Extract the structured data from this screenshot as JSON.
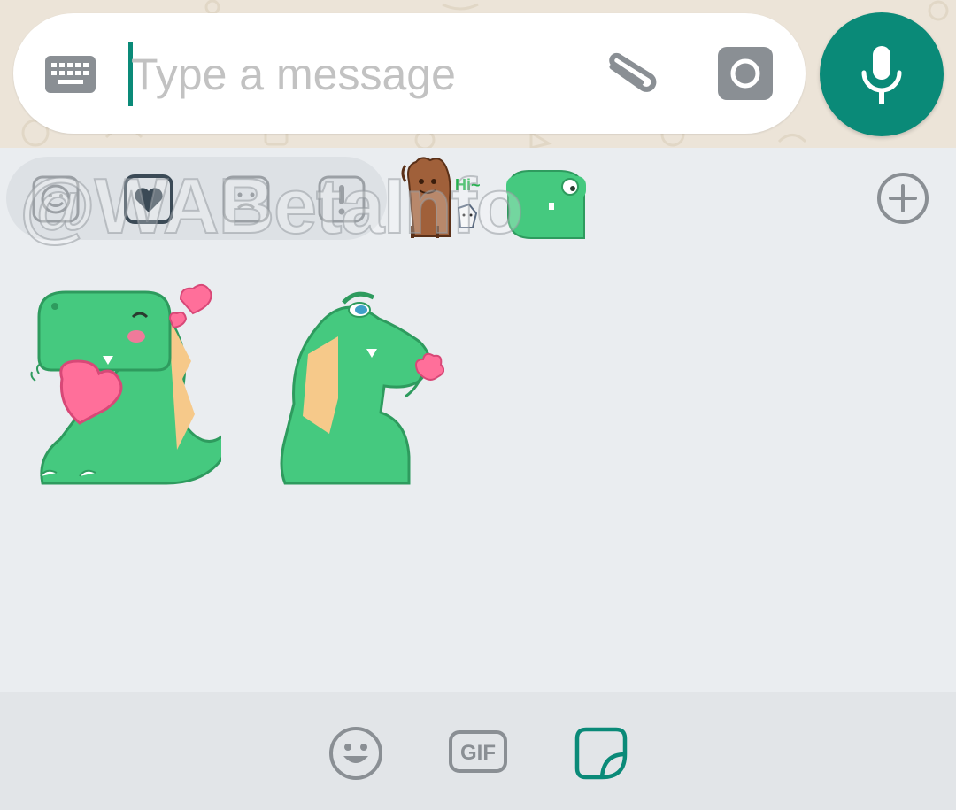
{
  "composer": {
    "placeholder": "Type a message",
    "keyboard_icon": "keyboard-icon",
    "attach_icon": "paperclip-icon",
    "camera_icon": "camera-icon",
    "mic_icon": "microphone-icon"
  },
  "sticker_tabs": {
    "categories": [
      {
        "icon": "smiley-icon"
      },
      {
        "icon": "heart-icon",
        "selected": true
      },
      {
        "icon": "sad-face-icon"
      },
      {
        "icon": "exclamation-icon"
      }
    ],
    "packs": [
      {
        "icon": "cuppy-pack-icon",
        "sticker_text": "Hi~"
      },
      {
        "icon": "dino-pack-icon"
      }
    ],
    "add_icon": "plus-circle-icon"
  },
  "watermark": "@WABetaInfo",
  "stickers": [
    {
      "name": "dino-with-heart"
    },
    {
      "name": "dino-with-flower"
    }
  ],
  "bottom_bar": {
    "emoji_icon": "emoji-icon",
    "gif_label": "GIF",
    "sticker_icon": "sticker-icon"
  },
  "colors": {
    "accent": "#0a8a78",
    "icon_grey": "#8a8f94",
    "panel_bg": "#eaedf0",
    "bottom_bg": "#e2e5e8",
    "dino_green": "#45c97f"
  }
}
